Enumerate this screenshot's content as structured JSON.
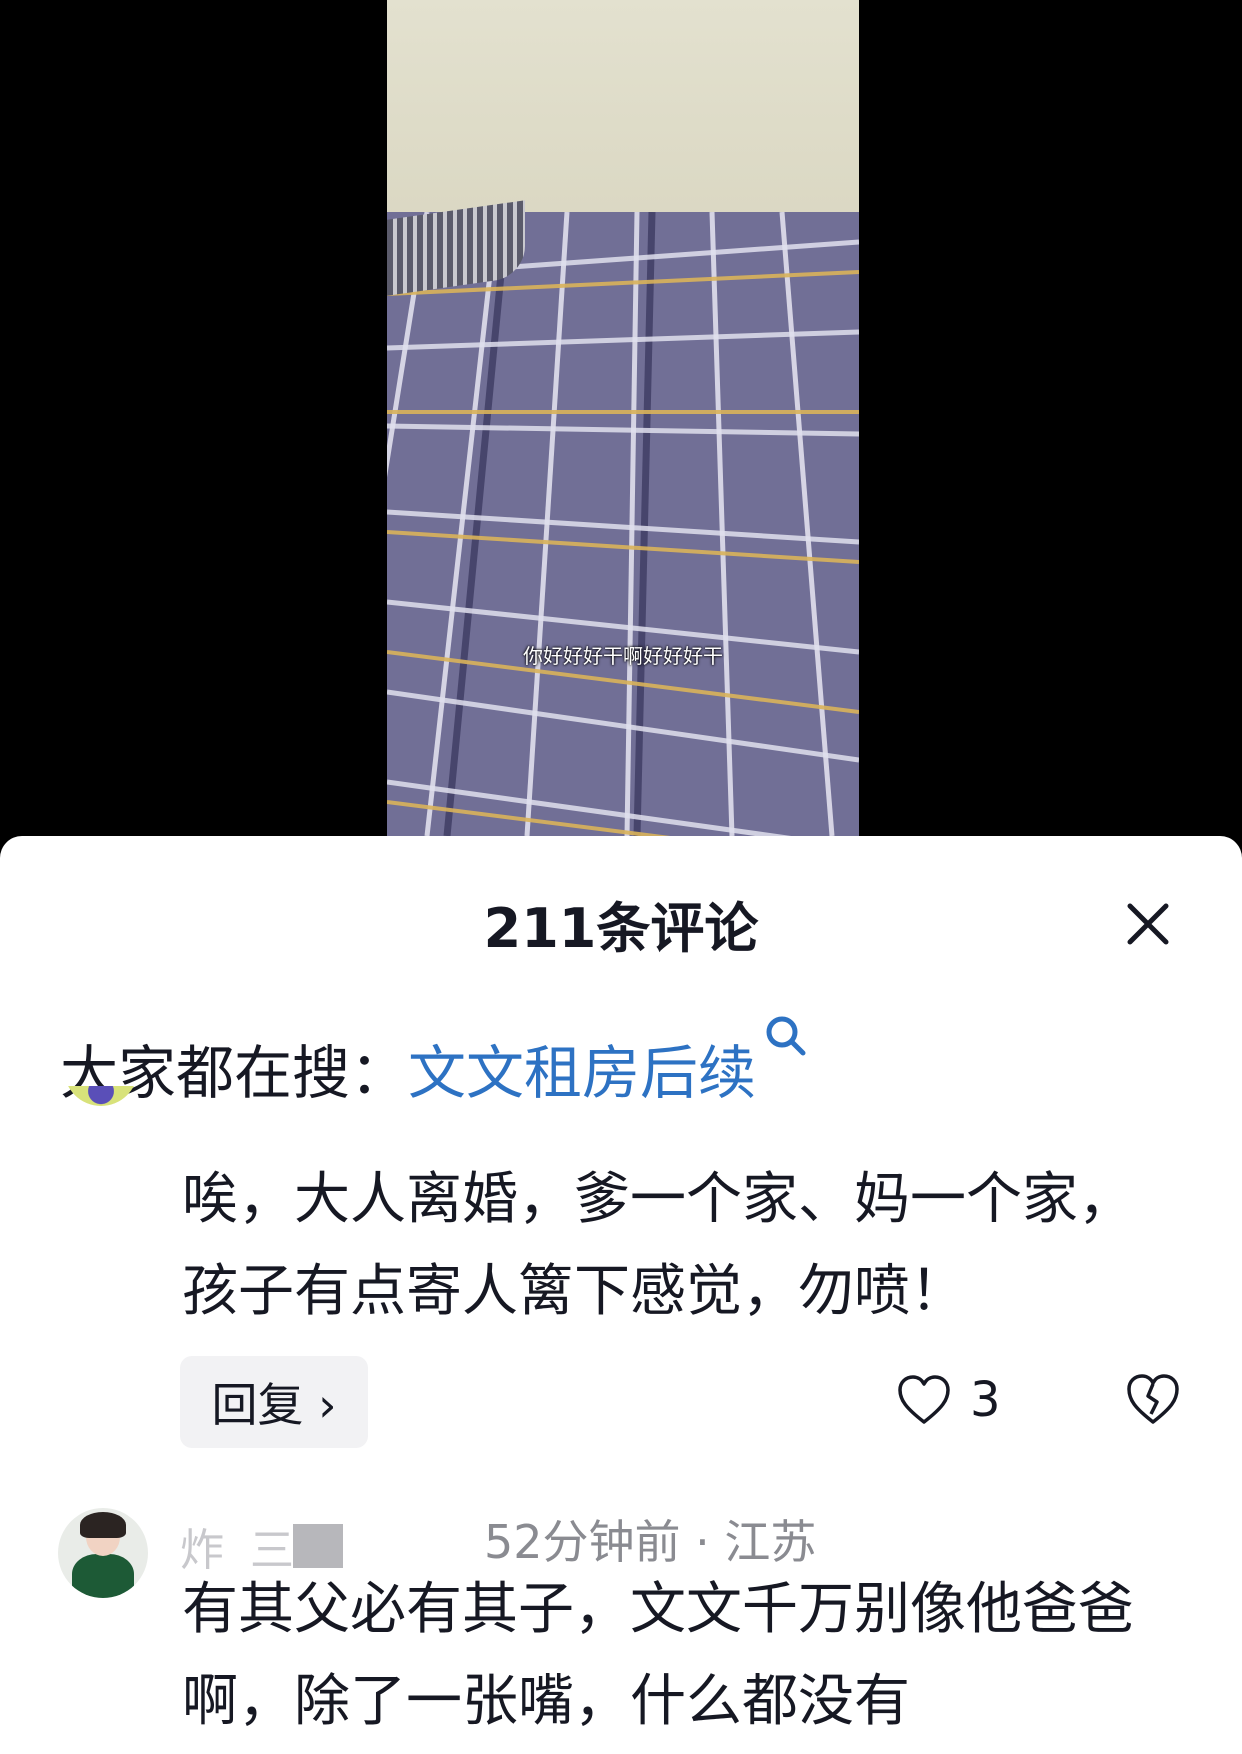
{
  "video": {
    "subtitle": "你好好好干啊好好好干"
  },
  "comments_panel": {
    "title": "211条评论",
    "search": {
      "prefix": "大家都在搜：",
      "term": "文文租房后续"
    },
    "comments": [
      {
        "text": "唉，大人离婚，爹一个家、妈一个家，孩子有点寄人篱下感觉，勿喷！",
        "reply_label": "回复 ›",
        "likes": "3"
      },
      {
        "name": "炸 三",
        "meta": "52分钟前 · 江苏",
        "text": "有其父必有其子，文文千万别像他爸爸啊，除了一张嘴，什么都没有"
      }
    ]
  },
  "colors": {
    "link": "#2d72c3",
    "text": "#161823",
    "meta": "#8a8b91",
    "reply_bg": "#f2f2f4"
  },
  "icons": [
    "close-icon",
    "search-icon",
    "heart-icon",
    "broken-heart-icon"
  ]
}
